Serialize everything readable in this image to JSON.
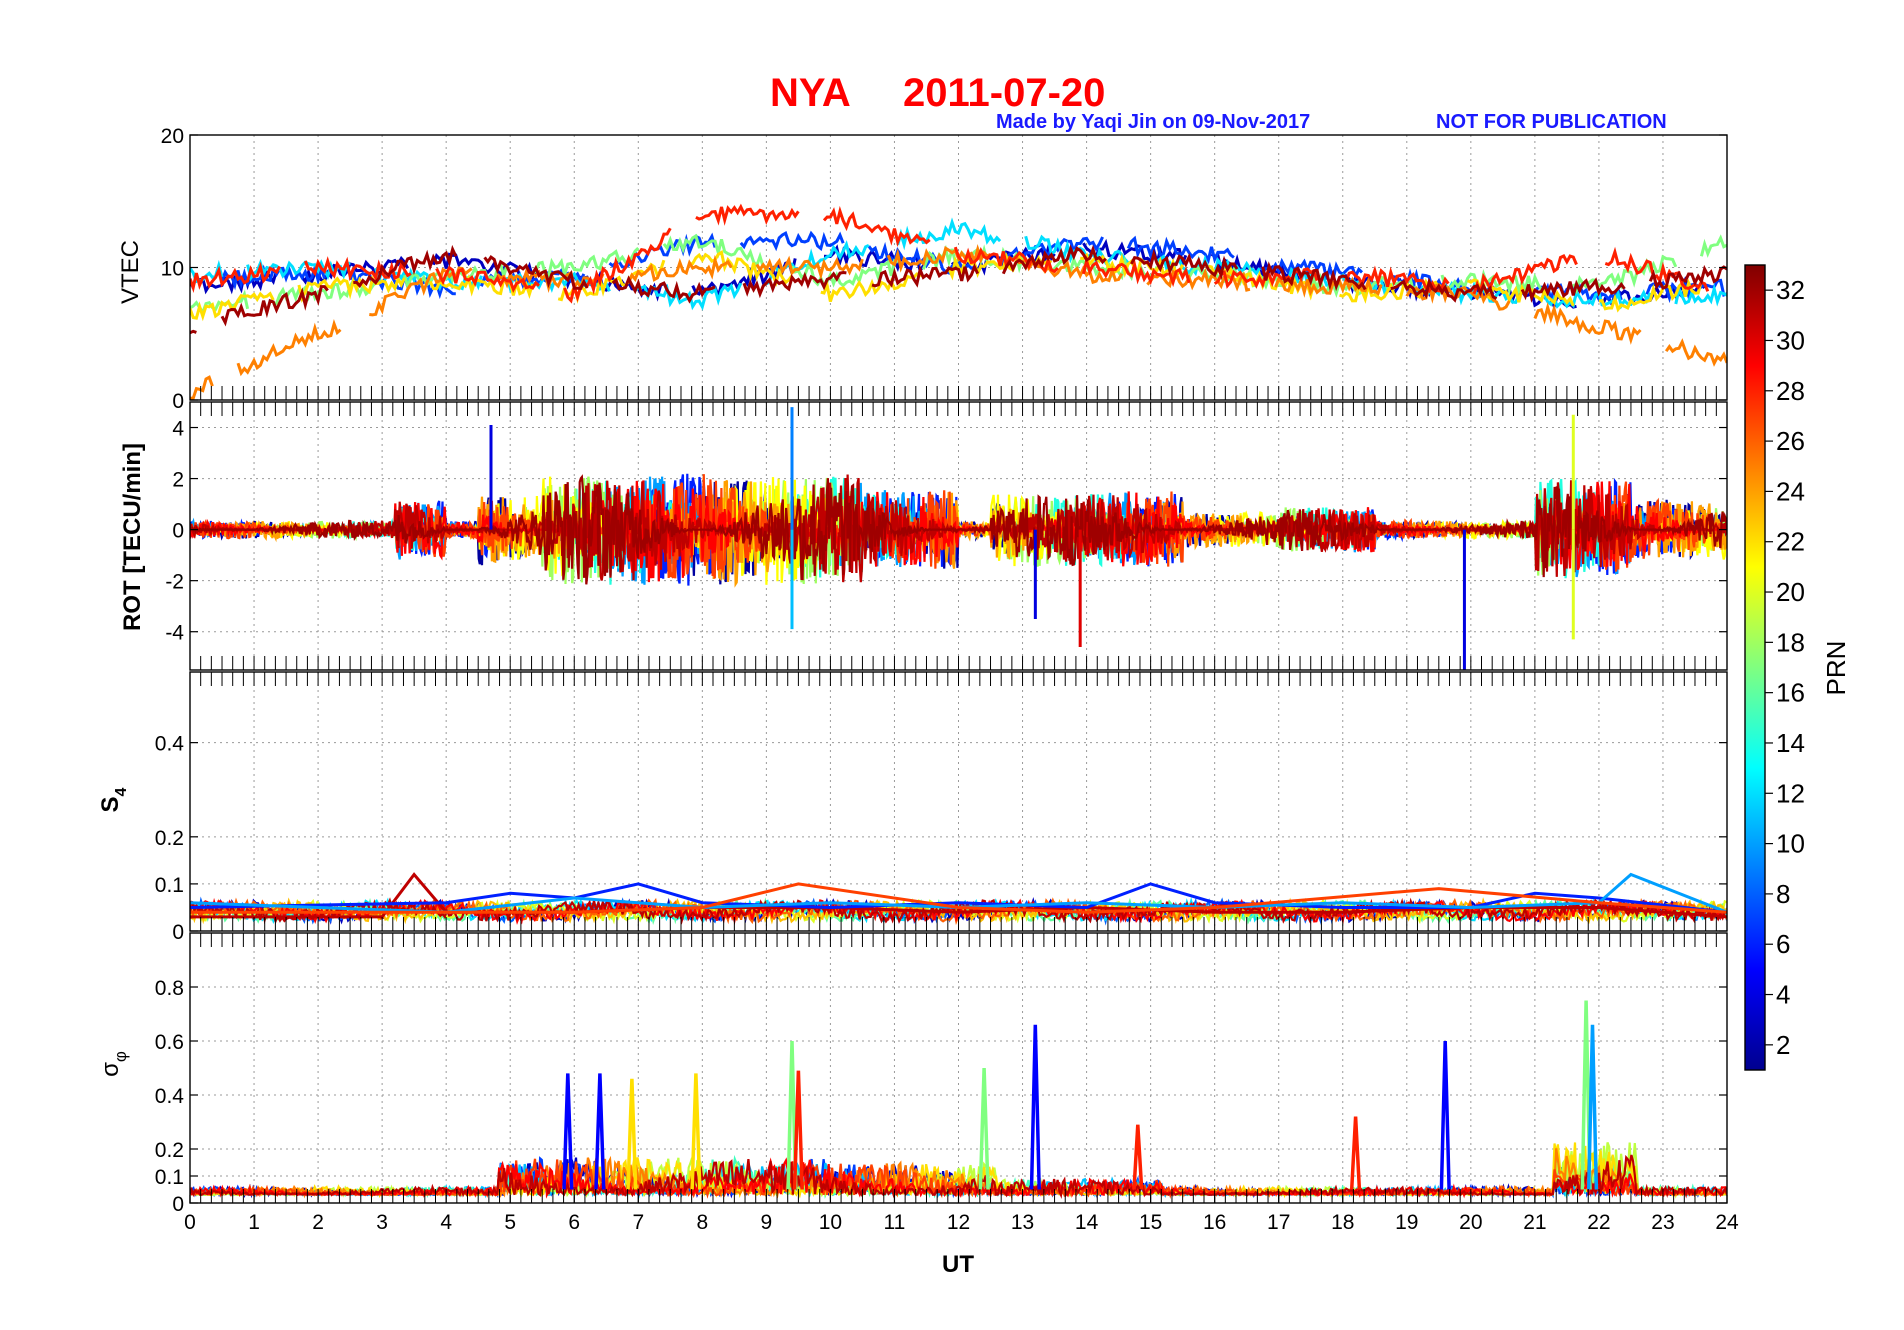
{
  "title": {
    "station": "NYA",
    "date": "2011-07-20"
  },
  "credit": {
    "made_by": "Made by Yaqi Jin on 09-Nov-2017",
    "notice": "NOT FOR PUBLICATION"
  },
  "colorbar": {
    "label": "PRN",
    "ticks": [
      "2",
      "4",
      "6",
      "8",
      "10",
      "12",
      "14",
      "16",
      "18",
      "20",
      "22",
      "24",
      "26",
      "28",
      "30",
      "32"
    ],
    "range": [
      1,
      33
    ],
    "colormap": "jet"
  },
  "chart_data": [
    {
      "type": "line",
      "panel": "VTEC",
      "ylabel": "VTEC",
      "xlim": [
        0,
        24
      ],
      "ylim": [
        0,
        20
      ],
      "yticks": [
        "0",
        "10",
        "20"
      ],
      "grid": true,
      "series": [
        {
          "prn": 3,
          "x": [
            0,
            2,
            4,
            6,
            8,
            10,
            12,
            14,
            16,
            18,
            20,
            22,
            24
          ],
          "y": [
            8.5,
            9.5,
            10.5,
            9,
            8,
            11,
            10,
            11.5,
            10.5,
            9,
            8,
            7.5,
            9
          ]
        },
        {
          "prn": 7,
          "x": [
            0,
            2,
            4,
            6,
            8,
            10,
            12,
            14,
            16,
            18,
            20,
            22,
            24
          ],
          "y": [
            9,
            9.5,
            8.5,
            9.5,
            12,
            12,
            10,
            12,
            11,
            9.5,
            8.5,
            8,
            8.5
          ]
        },
        {
          "prn": 12,
          "x": [
            0,
            2,
            4,
            6,
            8,
            10,
            12,
            14,
            16,
            18,
            20,
            22,
            24
          ],
          "y": [
            9.5,
            10,
            9,
            9,
            7.5,
            11,
            13,
            11,
            10,
            9,
            8,
            7.5,
            8
          ]
        },
        {
          "prn": 17,
          "x": [
            0,
            2,
            4,
            6,
            8,
            10,
            12,
            14,
            16,
            18,
            20,
            22,
            24
          ],
          "y": [
            7,
            8,
            9.5,
            10,
            12,
            9,
            11,
            10,
            9.5,
            8.5,
            9,
            8.5,
            12
          ]
        },
        {
          "prn": 22,
          "x": [
            0,
            2,
            4,
            6,
            8,
            10,
            12,
            14,
            16,
            18,
            20,
            22,
            24
          ],
          "y": [
            6.5,
            8.5,
            9,
            8,
            11,
            8,
            10,
            10.5,
            9.5,
            8,
            8.5,
            7,
            9
          ]
        },
        {
          "prn": 25,
          "x": [
            0,
            2,
            4,
            6,
            8,
            10,
            12,
            14,
            16,
            18,
            20,
            22,
            24
          ],
          "y": [
            0.5,
            5,
            9.5,
            9,
            10,
            10,
            11,
            9.5,
            9,
            8.5,
            8,
            5.5,
            3
          ]
        },
        {
          "prn": 28,
          "x": [
            0,
            2,
            4,
            6,
            8,
            10,
            12,
            14,
            16,
            18,
            20,
            22,
            24
          ],
          "y": [
            9,
            10,
            9.5,
            8,
            14,
            14,
            11,
            10,
            9,
            9.5,
            8.5,
            11,
            8
          ]
        },
        {
          "prn": 32,
          "x": [
            0,
            2,
            4,
            6,
            8,
            10,
            12,
            14,
            16,
            18,
            20,
            22,
            24
          ],
          "y": [
            5.5,
            8,
            11,
            9,
            8,
            9,
            9.5,
            11,
            10,
            9,
            8,
            8.5,
            9.5
          ]
        }
      ]
    },
    {
      "type": "line",
      "panel": "ROT",
      "ylabel": "ROT [TECU/min]",
      "xlim": [
        0,
        24
      ],
      "ylim": [
        -5.5,
        5
      ],
      "yticks": [
        "-4",
        "-2",
        "0",
        "2",
        "4"
      ],
      "grid": true,
      "series": [
        {
          "prn": 4,
          "x": [
            4.7,
            13.2,
            19.9
          ],
          "y": [
            4.1,
            -3.5,
            -5.5
          ]
        },
        {
          "prn": 9,
          "x": [
            9.4
          ],
          "y": [
            4.8
          ]
        },
        {
          "prn": 11,
          "x": [
            9.4
          ],
          "y": [
            -3.9
          ]
        },
        {
          "prn": 20,
          "x": [
            21.6,
            21.6
          ],
          "y": [
            4.5,
            -4.3
          ]
        },
        {
          "prn": 30,
          "x": [
            13.9
          ],
          "y": [
            -4.6
          ]
        }
      ]
    },
    {
      "type": "line",
      "panel": "S4",
      "ylabel": "S4",
      "xlim": [
        0,
        24
      ],
      "ylim": [
        0,
        0.55
      ],
      "yticks": [
        "0",
        "0.1",
        "0.2",
        "0.4"
      ],
      "grid": true,
      "series": [
        {
          "prn": 31,
          "x": [
            0,
            3,
            3.5,
            4,
            6,
            8,
            10,
            12,
            14,
            16,
            18,
            20,
            22,
            24
          ],
          "y": [
            0.03,
            0.03,
            0.12,
            0.04,
            0.04,
            0.05,
            0.05,
            0.04,
            0.05,
            0.04,
            0.04,
            0.05,
            0.05,
            0.03
          ]
        },
        {
          "prn": 6,
          "x": [
            0,
            4,
            5,
            6,
            7,
            8,
            10,
            12,
            14,
            15,
            16,
            18,
            20,
            21,
            22,
            24
          ],
          "y": [
            0.05,
            0.06,
            0.08,
            0.07,
            0.1,
            0.06,
            0.05,
            0.06,
            0.05,
            0.1,
            0.06,
            0.05,
            0.05,
            0.08,
            0.07,
            0.04
          ]
        },
        {
          "prn": 10,
          "x": [
            0,
            4,
            6,
            8,
            10,
            12,
            14,
            16,
            18,
            20,
            22,
            22.5,
            24
          ],
          "y": [
            0.06,
            0.04,
            0.07,
            0.05,
            0.06,
            0.05,
            0.06,
            0.05,
            0.06,
            0.05,
            0.06,
            0.12,
            0.04
          ]
        },
        {
          "prn": 27,
          "x": [
            0,
            6,
            8,
            9.5,
            12,
            14,
            16,
            19.5,
            22,
            24
          ],
          "y": [
            0.04,
            0.04,
            0.05,
            0.1,
            0.05,
            0.04,
            0.05,
            0.09,
            0.06,
            0.04
          ]
        }
      ]
    },
    {
      "type": "line",
      "panel": "sigma_phi",
      "ylabel": "σφ",
      "xlabel": "UT",
      "xlim": [
        0,
        24
      ],
      "ylim": [
        0,
        1
      ],
      "yticks": [
        "0",
        "0.1",
        "0.2",
        "0.4",
        "0.6",
        "0.8"
      ],
      "xticks": [
        "0",
        "1",
        "2",
        "3",
        "4",
        "5",
        "6",
        "7",
        "8",
        "9",
        "10",
        "11",
        "12",
        "13",
        "14",
        "15",
        "16",
        "17",
        "18",
        "19",
        "20",
        "21",
        "22",
        "23",
        "24"
      ],
      "grid": true,
      "series": [
        {
          "prn": 5,
          "x": [
            5.9,
            6.4,
            13.2,
            19.6
          ],
          "y": [
            0.48,
            0.48,
            0.66,
            0.6
          ]
        },
        {
          "prn": 22,
          "x": [
            6.9,
            7.9
          ],
          "y": [
            0.46,
            0.48
          ]
        },
        {
          "prn": 17,
          "x": [
            9.4,
            12.4,
            21.8
          ],
          "y": [
            0.6,
            0.5,
            0.75
          ]
        },
        {
          "prn": 10,
          "x": [
            21.9
          ],
          "y": [
            0.66
          ]
        },
        {
          "prn": 28,
          "x": [
            9.5,
            18.2,
            14.8
          ],
          "y": [
            0.49,
            0.32,
            0.29
          ]
        }
      ]
    }
  ]
}
